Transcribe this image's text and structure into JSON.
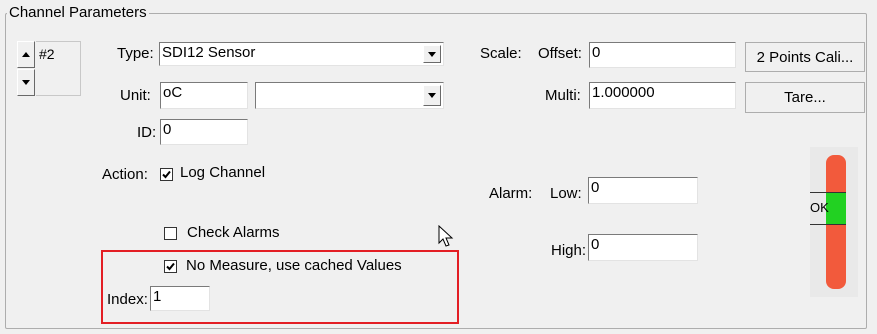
{
  "group": {
    "title": "Channel Parameters"
  },
  "channel": {
    "number": "#2"
  },
  "type": {
    "label": "Type:",
    "value": "SDI12 Sensor"
  },
  "unit": {
    "label": "Unit:",
    "value": "oC",
    "dropdown_value": ""
  },
  "id_field": {
    "label": "ID:",
    "value": "0"
  },
  "action": {
    "label": "Action:",
    "log_channel": {
      "label": "Log Channel",
      "checked": true
    },
    "check_alarms": {
      "label": "Check Alarms",
      "checked": false
    },
    "no_measure": {
      "label": "No Measure, use cached Values",
      "checked": true
    }
  },
  "index": {
    "label": "Index:",
    "value": "1"
  },
  "scale": {
    "label": "Scale:",
    "offset_label": "Offset:",
    "offset_value": "0",
    "multi_label": "Multi:",
    "multi_value": "1.000000"
  },
  "buttons": {
    "two_points": "2 Points Cali...",
    "tare": "Tare..."
  },
  "alarm": {
    "label": "Alarm:",
    "low_label": "Low:",
    "low_value": "0",
    "high_label": "High:",
    "high_value": "0"
  },
  "indicator": {
    "status": "OK",
    "colors": {
      "high": "#f25a3c",
      "ok": "#22d122",
      "low": "#f25a3c"
    }
  },
  "colors": {
    "highlight_border": "#e31e24"
  }
}
